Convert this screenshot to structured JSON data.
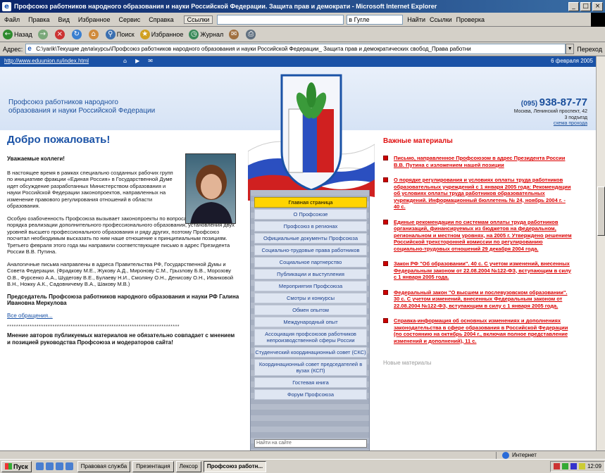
{
  "window": {
    "title": "Профсоюз работников народного образования и науки Российской Федерации. Защита прав и демократи - Microsoft Internet Explorer",
    "buttons": [
      "_",
      "□",
      "×"
    ]
  },
  "menubar": {
    "items": [
      "Файл",
      "Правка",
      "Вид",
      "Избранное",
      "Сервис",
      "Справка"
    ],
    "links_label": "Ссылки",
    "search_engine": "в Гугле",
    "search_label": "Найти",
    "search_button": "Ссылки",
    "wsearch_label": "Проверка"
  },
  "toolbar": {
    "back": "Назад",
    "search": "Поиск",
    "favorites": "Избранное",
    "media": "Журнал"
  },
  "address": {
    "label": "Адрес:",
    "url": "C:\\yarik\\Текущие дела\\курсы\\Профсоюз работников народного образования и науки Российской Федерации_ Защита прав и демократических свобод_Права работни",
    "go_label": "Переход"
  },
  "site": {
    "top_url": "http://www.eduunion.ru/index.html",
    "date": "6 февраля 2005",
    "org_name_line1": "Профсоюз работников народного",
    "org_name_line2": "образования и науки Российской Федерации",
    "phone_code": "(095)",
    "phone_number": "938-87-77",
    "address_line1": "Москва, Ленинский проспект, 42",
    "address_line2": "3 подъезд",
    "address_link": "схема прохода"
  },
  "welcome": {
    "title": "Добро пожаловать!",
    "greeting": "Уважаемые коллеги!",
    "p1": "В настоящее время в рамках специально созданных рабочих групп по инициативе фракции «Единая Россия» в Государственной Думе идет обсуждение разработанных Министерством образования и науки Российской Федерации законопроектов, направленных на изменение правового регулирования отношений в области образования.",
    "p2": "Особую озабоченность Профсоюза вызывает законопроекты по вопросам изменения порядка реализации дополнительного профессионального образования, установления двух уровней высшего профессионального образования и ряду других, поэтому Профсоюз посчитал необходимым высказать по ним наше отношение к принципиальным позициям.",
    "p3": "Третьего февраля этого года мы направили соответствующее письмо в адрес Президента России В.В. Путина.",
    "p4": "Аналогичные письма направлены в адреса Правительства РФ, Государственной Думы и Совета Федерации. (Фрадкову М.Е., Жукову А.Д., Миронову С.М., Грызлову Б.В., Морозову О.В., Фурсенко А.А., Шудегову В.Е., Булаеву Н.И., Смоляну О.Н., Денисову О.Н., Иванковой В.Н., Ножку А.К., Садовничему В.А., Шакову М.В.)",
    "signature": "Председатель Профсоюза работников народного образования и науки РФ Галина Ивановна Меркулова",
    "all_link": "Все обращения...",
    "stars": "****************************************************************************",
    "disclaimer": "Мнение авторов публикуемых материалов не обязательно совпадает с мнением и позицией руководства Профсоюза и модераторов сайта!"
  },
  "nav": {
    "items": [
      "Главная страница",
      "О Профсоюзе",
      "Профсоюз в регионах",
      "Официальные документы Профсоюза",
      "Социально-трудовые права работников",
      "Социальное партнерство",
      "Публикации и выступления",
      "Мероприятия Профсоюза",
      "Смотры и конкурсы",
      "Обмен опытом",
      "Международный опыт",
      "Ассоциация профсоюзов работников непроизводственной сферы России",
      "Студенческий координационный совет (СКС)",
      "Координационный совет председателей в вузах (КСП)",
      "Гостевая книга",
      "Форум Профсоюза"
    ],
    "search_placeholder": "Найти на сайте"
  },
  "important": {
    "title": "Важные материалы",
    "items": [
      "Письмо, направленное Профсоюзом в адрес Президента России В.В. Путина с изложением нашей позиции",
      "О порядке регулирования и условиях оплаты труда работников образовательных учреждений с 1 января 2005 года: Рекомендации об условиях оплаты труда работников образовательных учреждений. Информационный бюллетень № 24, ноябрь 2004 г. - 40 с.",
      "Единые рекомендации по системам оплаты труда работников организаций, финансируемых из бюджетов на федеральном, региональном и местном уровнях, на 2005 г. Утверждено решением Российской трехсторонней комиссии по регулированию социально-трудовых отношений 29 декабря 2004 года.",
      "Закон РФ \"Об образовании\". 40 с. С учетом изменений, внесенных Федеральным законом от 22.08.2004 №122-ФЗ, вступающим в силу с 1 января 2005 года.",
      "Федеральный закон \"О высшем и послевузовском образовании\". 30 с. С учетом изменений, внесенных Федеральным законом от 22.08.2004 №122-ФЗ, вступающим в силу с 1 января 2005 года.",
      "Справка-информация об основных изменениях и дополнениях законодательства в сфере образования в Российской Федерации (по состоянию на октябрь 2004 г., включая полное представление изменений и дополнений), 11 с."
    ],
    "more_title": "Новые материалы"
  },
  "status": {
    "text": "",
    "zone": "Интернет"
  },
  "taskbar": {
    "start": "Пуск",
    "tasks": [
      "Правовая служба",
      "Презентация",
      "Лексор",
      "Профсоюз работн..."
    ],
    "clock": "12:09"
  },
  "colors": {
    "accent": "#1a52a6",
    "important_red": "#e01010",
    "nav_active": "#ffd400"
  }
}
